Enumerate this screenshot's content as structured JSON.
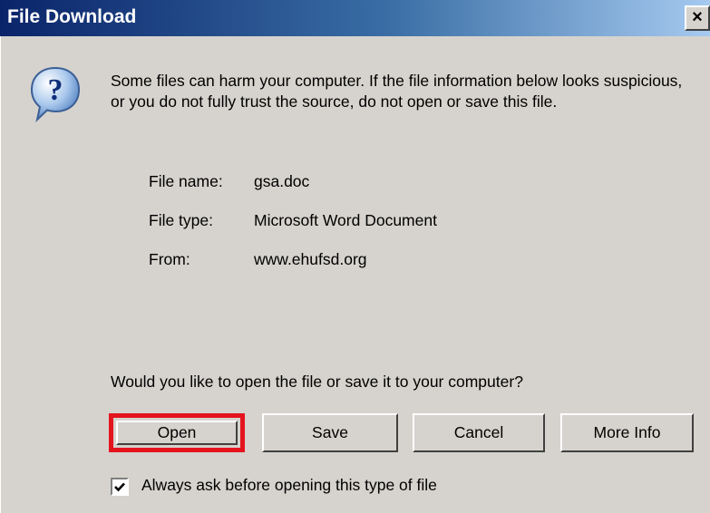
{
  "window": {
    "title": "File Download",
    "close_glyph": "×",
    "close_icon": "close-icon"
  },
  "icon": "question-mark-icon",
  "warning_text": "Some files can harm your computer. If the file information below looks suspicious, or you do not fully trust the source, do not open or save this file.",
  "file_info": {
    "name_label": "File name:",
    "name_value": "gsa.doc",
    "type_label": "File type:",
    "type_value": "Microsoft Word Document",
    "from_label": "From:",
    "from_value": "www.ehufsd.org"
  },
  "prompt": "Would you like to open the file or save it to your computer?",
  "buttons": {
    "open": "Open",
    "save": "Save",
    "cancel": "Cancel",
    "more_info": "More Info"
  },
  "checkbox": {
    "label": "Always ask before opening this type of file",
    "checked": true
  },
  "colors": {
    "dialog_bg": "#d6d3ce",
    "title_bar": "#0a246a",
    "highlight": "#e4141e"
  }
}
